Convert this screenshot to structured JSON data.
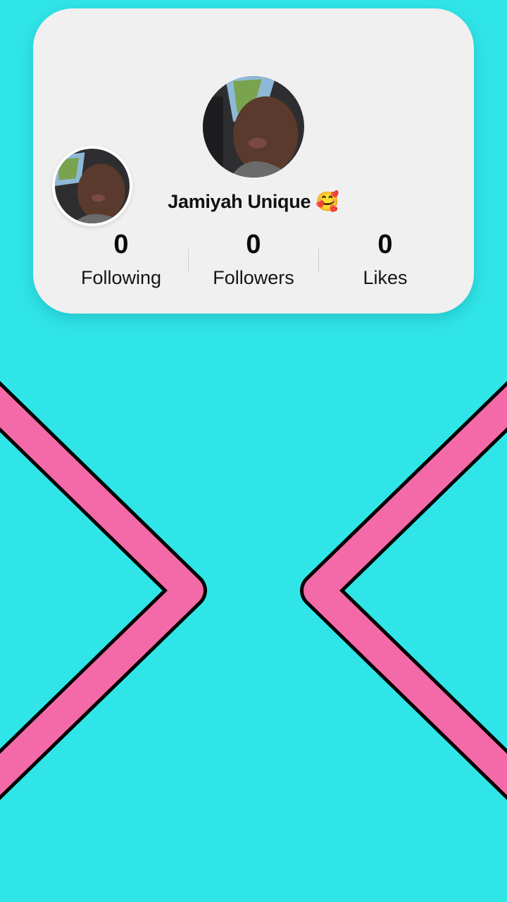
{
  "profile": {
    "display_name": "Jamiyah Unique 🥰"
  },
  "stats": {
    "following": {
      "value": "0",
      "label": "Following"
    },
    "followers": {
      "value": "0",
      "label": "Followers"
    },
    "likes": {
      "value": "0",
      "label": "Likes"
    }
  },
  "colors": {
    "background": "#30e5e8",
    "card": "#f0f0f0",
    "chevron_fill": "#f46aa8",
    "chevron_outline": "#000000"
  },
  "icons": {
    "left_chevron": "chevron-right-icon",
    "right_chevron": "chevron-left-icon"
  }
}
